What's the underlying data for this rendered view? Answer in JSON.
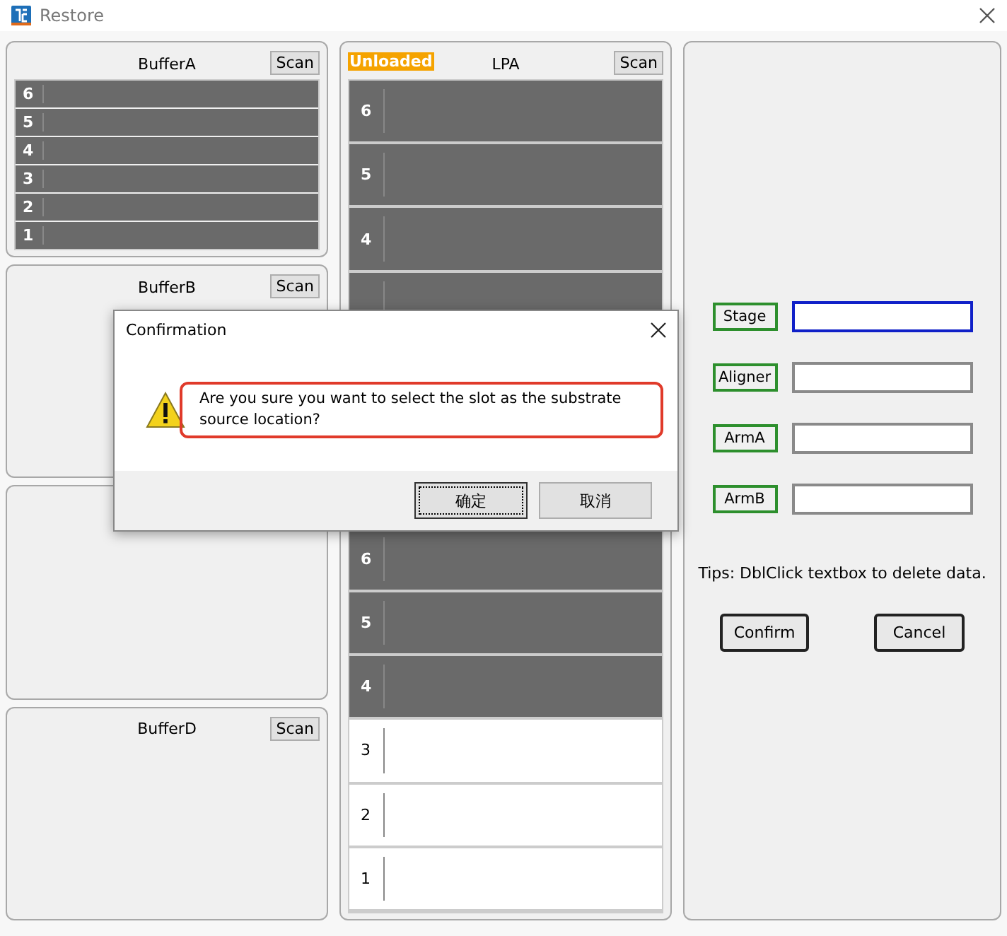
{
  "window": {
    "title": "Restore"
  },
  "buffers": [
    {
      "kind": "panel",
      "title": "BufferA",
      "scan": "Scan",
      "slots": [
        {
          "label": "6",
          "occupied": true
        },
        {
          "label": "5",
          "occupied": true
        },
        {
          "label": "4",
          "occupied": true
        },
        {
          "label": "3",
          "occupied": true
        },
        {
          "label": "2",
          "occupied": true
        },
        {
          "label": "1",
          "occupied": true
        }
      ]
    },
    {
      "kind": "panel",
      "title": "BufferB",
      "scan": "Scan"
    },
    {
      "kind": "covered"
    },
    {
      "kind": "panel",
      "title": "BufferD",
      "scan": "Scan"
    }
  ],
  "lpa": {
    "status": "Unloaded",
    "title": "LPA",
    "scan": "Scan",
    "upper_slots": [
      {
        "label": "6",
        "occupied": true
      },
      {
        "label": "5",
        "occupied": true
      },
      {
        "label": "4",
        "occupied": true
      },
      {
        "occupied": true
      }
    ],
    "lower_slots": [
      {
        "label": "6",
        "occupied": true
      },
      {
        "label": "5",
        "occupied": true
      },
      {
        "label": "4",
        "occupied": true
      },
      {
        "label": "3",
        "occupied": false
      },
      {
        "label": "2",
        "occupied": false
      },
      {
        "label": "1",
        "occupied": false
      }
    ]
  },
  "targets": [
    {
      "label": "Stage",
      "focused": true
    },
    {
      "label": "Aligner",
      "focused": false
    },
    {
      "label": "ArmA",
      "focused": false
    },
    {
      "label": "ArmB",
      "focused": false
    }
  ],
  "tips": "Tips: DblClick textbox to delete data.",
  "buttons": [
    "Confirm",
    "Cancel"
  ],
  "dialog": {
    "title": "Confirmation",
    "message": "Are you sure you want to select the slot as the substrate source location?",
    "highlighted": true,
    "buttons": [
      {
        "label": "确定",
        "focused": true
      },
      {
        "label": "取消",
        "focused": false
      }
    ]
  }
}
